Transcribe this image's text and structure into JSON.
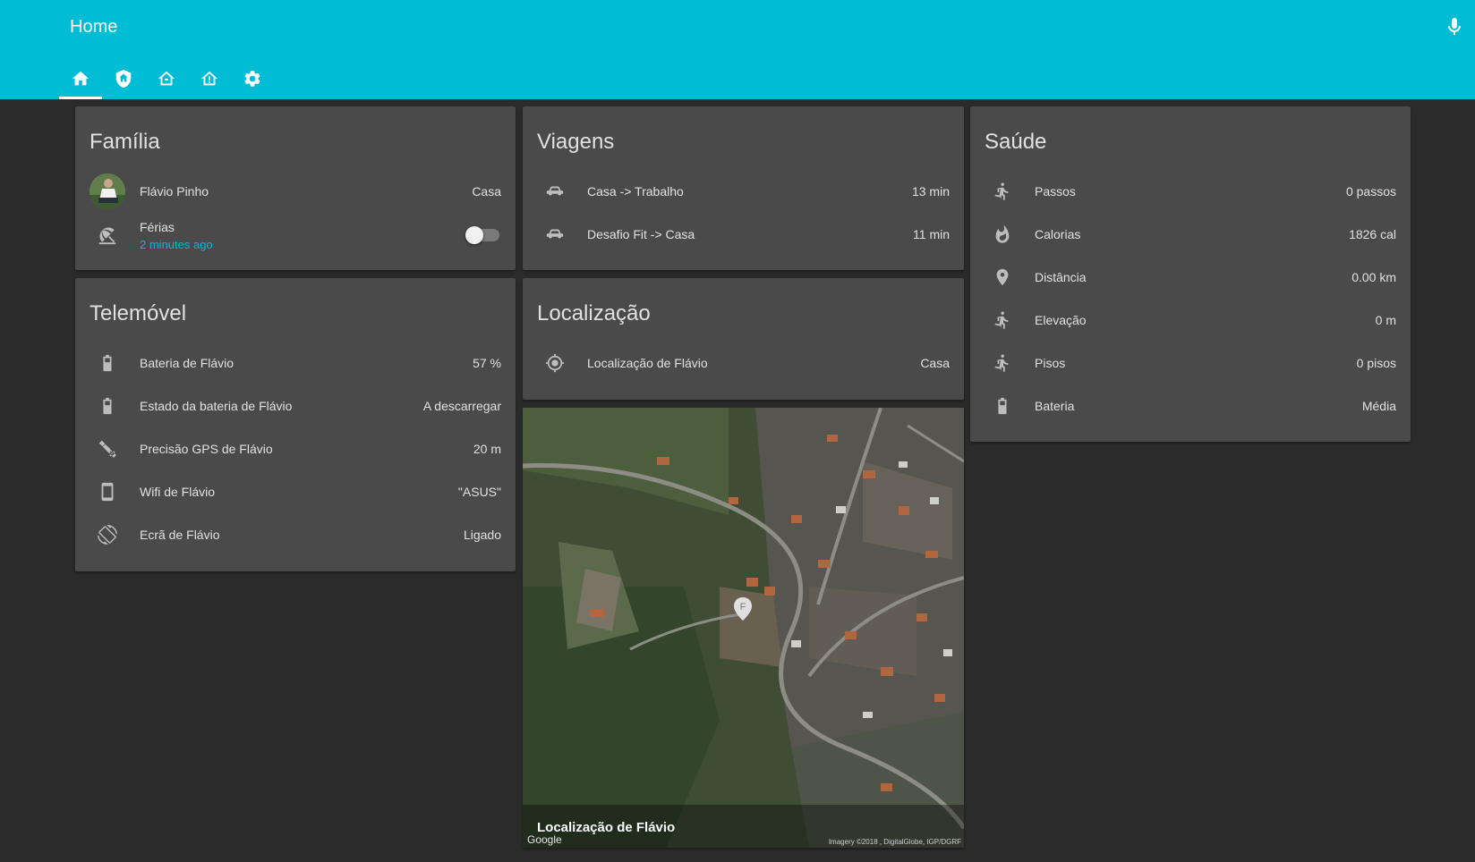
{
  "app": {
    "title": "Home",
    "tabs": [
      {
        "icon": "home-icon",
        "active": true
      },
      {
        "icon": "home-shield-icon",
        "active": false
      },
      {
        "icon": "home-outline-icon",
        "active": false
      },
      {
        "icon": "home-alert-icon",
        "active": false
      },
      {
        "icon": "gear-icon",
        "active": false
      }
    ],
    "accent_color": "#00bcd4",
    "card_color": "#4a4a4a",
    "background_color": "#2b2b2b"
  },
  "cards": {
    "familia": {
      "title": "Família",
      "person": {
        "name": "Flávio Pinho",
        "state": "Casa"
      },
      "ferias": {
        "name": "Férias",
        "last_changed": "2 minutes ago",
        "toggle_on": false
      }
    },
    "viagens": {
      "title": "Viagens",
      "rows": [
        {
          "icon": "car-icon",
          "name": "Casa -> Trabalho",
          "value": "13 min"
        },
        {
          "icon": "car-icon",
          "name": "Desafio Fit -> Casa",
          "value": "11 min"
        }
      ]
    },
    "saude": {
      "title": "Saúde",
      "rows": [
        {
          "icon": "walk-icon",
          "name": "Passos",
          "value": "0 passos"
        },
        {
          "icon": "fire-icon",
          "name": "Calorias",
          "value": "1826 cal"
        },
        {
          "icon": "map-marker-icon",
          "name": "Distância",
          "value": "0.00 km"
        },
        {
          "icon": "walk-icon",
          "name": "Elevação",
          "value": "0 m"
        },
        {
          "icon": "walk-icon",
          "name": "Pisos",
          "value": "0 pisos"
        },
        {
          "icon": "battery-icon",
          "name": "Bateria",
          "value": "Média"
        }
      ]
    },
    "telemovel": {
      "title": "Telemóvel",
      "rows": [
        {
          "icon": "battery-icon",
          "name": "Bateria de Flávio",
          "value": "57 %"
        },
        {
          "icon": "battery-icon",
          "name": "Estado da bateria de Flávio",
          "value": "A descarregar"
        },
        {
          "icon": "satellite-icon",
          "name": "Precisão GPS de Flávio",
          "value": "20 m"
        },
        {
          "icon": "cellphone-icon",
          "name": "Wifi de Flávio",
          "value": "\"ASUS\""
        },
        {
          "icon": "screen-rotation-icon",
          "name": "Ecrã de Flávio",
          "value": "Ligado"
        }
      ]
    },
    "localizacao": {
      "title": "Localização",
      "rows": [
        {
          "icon": "crosshairs-gps-icon",
          "name": "Localização de Flávio",
          "value": "Casa"
        }
      ]
    },
    "map": {
      "caption": "Localização de Flávio",
      "google_label": "Google",
      "attribution": "Imagery ©2018 , DigitalGlobe, IGP/DGRF",
      "marker_label": "F"
    }
  }
}
